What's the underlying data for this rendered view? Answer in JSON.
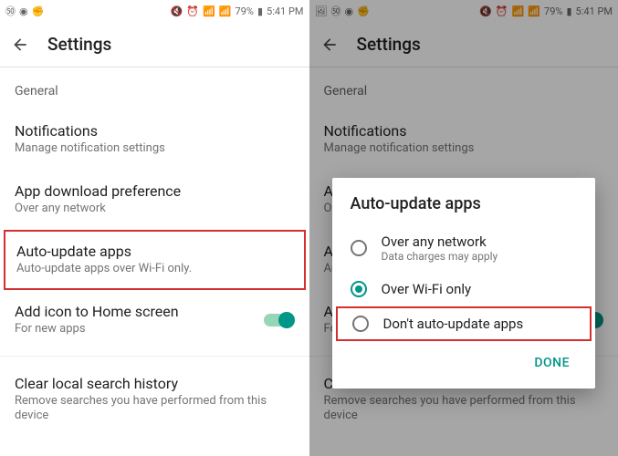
{
  "status": {
    "battery_pct": "79%",
    "time": "5:41 PM",
    "left_icons": [
      "79-badge",
      "rec-icon",
      "rock-hand-icon"
    ],
    "right_icons": [
      "image-icon",
      "mute-icon",
      "alarm-icon",
      "wifi-icon",
      "signal-icon",
      "battery-icon"
    ]
  },
  "header": {
    "title": "Settings"
  },
  "section": {
    "general": "General"
  },
  "items": {
    "notifications": {
      "title": "Notifications",
      "subtitle": "Manage notification settings"
    },
    "download_pref": {
      "title": "App download preference",
      "subtitle": "Over any network"
    },
    "auto_update": {
      "title": "Auto-update apps",
      "subtitle": "Auto-update apps over Wi-Fi only."
    },
    "add_icon": {
      "title": "Add icon to Home screen",
      "subtitle": "For new apps"
    },
    "clear_history": {
      "title": "Clear local search history",
      "subtitle": "Remove searches you have performed from this device"
    }
  },
  "dialog": {
    "title": "Auto-update apps",
    "options": [
      {
        "label": "Over any network",
        "sub": "Data charges may apply"
      },
      {
        "label": "Over Wi-Fi only",
        "sub": ""
      },
      {
        "label": "Don't auto-update apps",
        "sub": ""
      }
    ],
    "done": "DONE"
  },
  "right_screen_truncated": {
    "download_pref_title": "App do",
    "download_pref_sub": "Over an",
    "auto_update_title": "Auto-u",
    "auto_update_sub": "Auto-up",
    "add_icon_title": "Add",
    "add_icon_sub": "For ne",
    "clear_title": "Clear"
  }
}
